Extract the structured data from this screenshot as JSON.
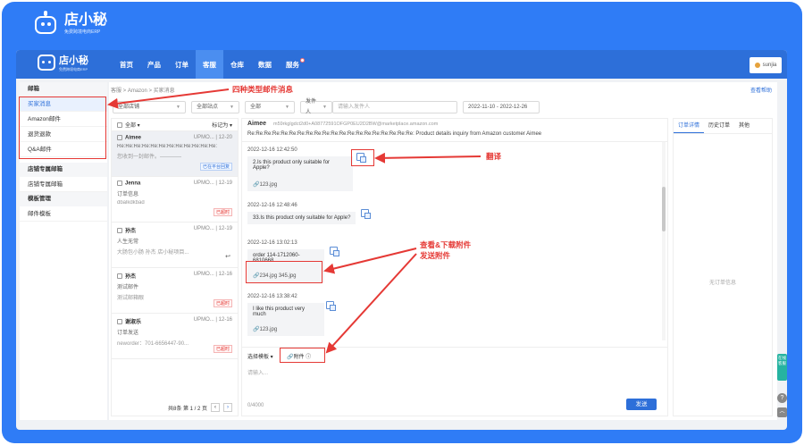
{
  "brand": {
    "name": "店小秘",
    "subtitle": "免费跨境电商ERP"
  },
  "nav": {
    "logo": "店小秘",
    "logo_sub": "免费跨境电商ERP",
    "items": [
      "首页",
      "产品",
      "订单",
      "客服",
      "仓库",
      "数据",
      "服务"
    ],
    "active": "客服",
    "user": "sunjia"
  },
  "sidebar": {
    "group1": "邮箱",
    "items1": [
      "买家消息",
      "Amazon邮件",
      "退货退款",
      "Q&A邮件"
    ],
    "group2": "店铺专属邮箱",
    "items2": [
      "店铺专属邮箱"
    ],
    "group3": "模板管理",
    "items3": [
      "邮件模板"
    ]
  },
  "breadcrumb": "客服 > Amazon > 买家消息",
  "help": "查看帮助",
  "filters": {
    "shop": "全部店铺",
    "site": "全部站点",
    "all": "全部",
    "sender": "发件人",
    "search_placeholder": "请输入发件人",
    "date_range": "2022-11-10 - 2022-12-26"
  },
  "list": {
    "select_all": "全部",
    "mark": "标记为",
    "items": [
      {
        "name": "Aimee",
        "meta": "UPMO... | 12-20",
        "line1": "Re:Re:Re:Re:Re:Re:Re:Re:Re:Re:Re:Re:",
        "line2": "您收到一封邮件。————",
        "tag": "已在平台回复"
      },
      {
        "name": "Jenna",
        "meta": "UPMO... | 12-19",
        "line1": "订单信息",
        "line2": "dbalkdkbad",
        "tag": "已超时"
      },
      {
        "name": "孙杰",
        "meta": "UPMO... | 12-19",
        "line1": "人生无常",
        "line2": "大肠包小肠 孙杰 店小秘项目...",
        "tag": ""
      },
      {
        "name": "孙杰",
        "meta": "UPMO... | 12-16",
        "line1": "测试邮件",
        "line2": "测试邮箱眼",
        "tag": "已超时"
      },
      {
        "name": "谢淑乐",
        "meta": "UPMO... | 12-16",
        "line1": "订单发送",
        "line2": "neworder：701-6656447-90...",
        "tag": "已超时"
      }
    ],
    "pager": "共8条  第 1 / 2 页"
  },
  "mail": {
    "sender": "Aimee",
    "address": "m59rkglgdct2d0+A08772591OFGP0EU2D2BW@marketplace.amazon.com",
    "subject": "Re:Re:Re:Re:Re:Re:Re:Re:Re:Re:Re:Re:Re:Re:Re:Re:Re:Re:Re:Re: Product details inquiry from Amazon customer Aimee",
    "messages": [
      {
        "time": "2022-12-16 12:42:50",
        "text": "2.Is this product only suitable for Apple?",
        "att": "123.jpg"
      },
      {
        "time": "2022-12-16 12:48:46",
        "text": "33.Is this product only suitable for Apple?",
        "att": ""
      },
      {
        "time": "2022-12-16 13:02:13",
        "text": "order  114-1712060-6810668",
        "att": "234.jpg   345.jpg"
      },
      {
        "time": "2022-12-16 13:38:42",
        "text": "I like this product very much",
        "att": "123.jpg"
      }
    ],
    "template": "选择模板",
    "attach": "附件",
    "input_placeholder": "请输入...",
    "count": "0/4000",
    "send": "发送"
  },
  "right": {
    "tabs": [
      "订单详情",
      "历史订单",
      "其他"
    ],
    "empty": "无订单信息"
  },
  "float": {
    "service": "在线客服"
  },
  "annotations": {
    "types": "四种类型邮件消息",
    "translate": "翻译",
    "attachments": "查看&下载附件\n发送附件"
  }
}
